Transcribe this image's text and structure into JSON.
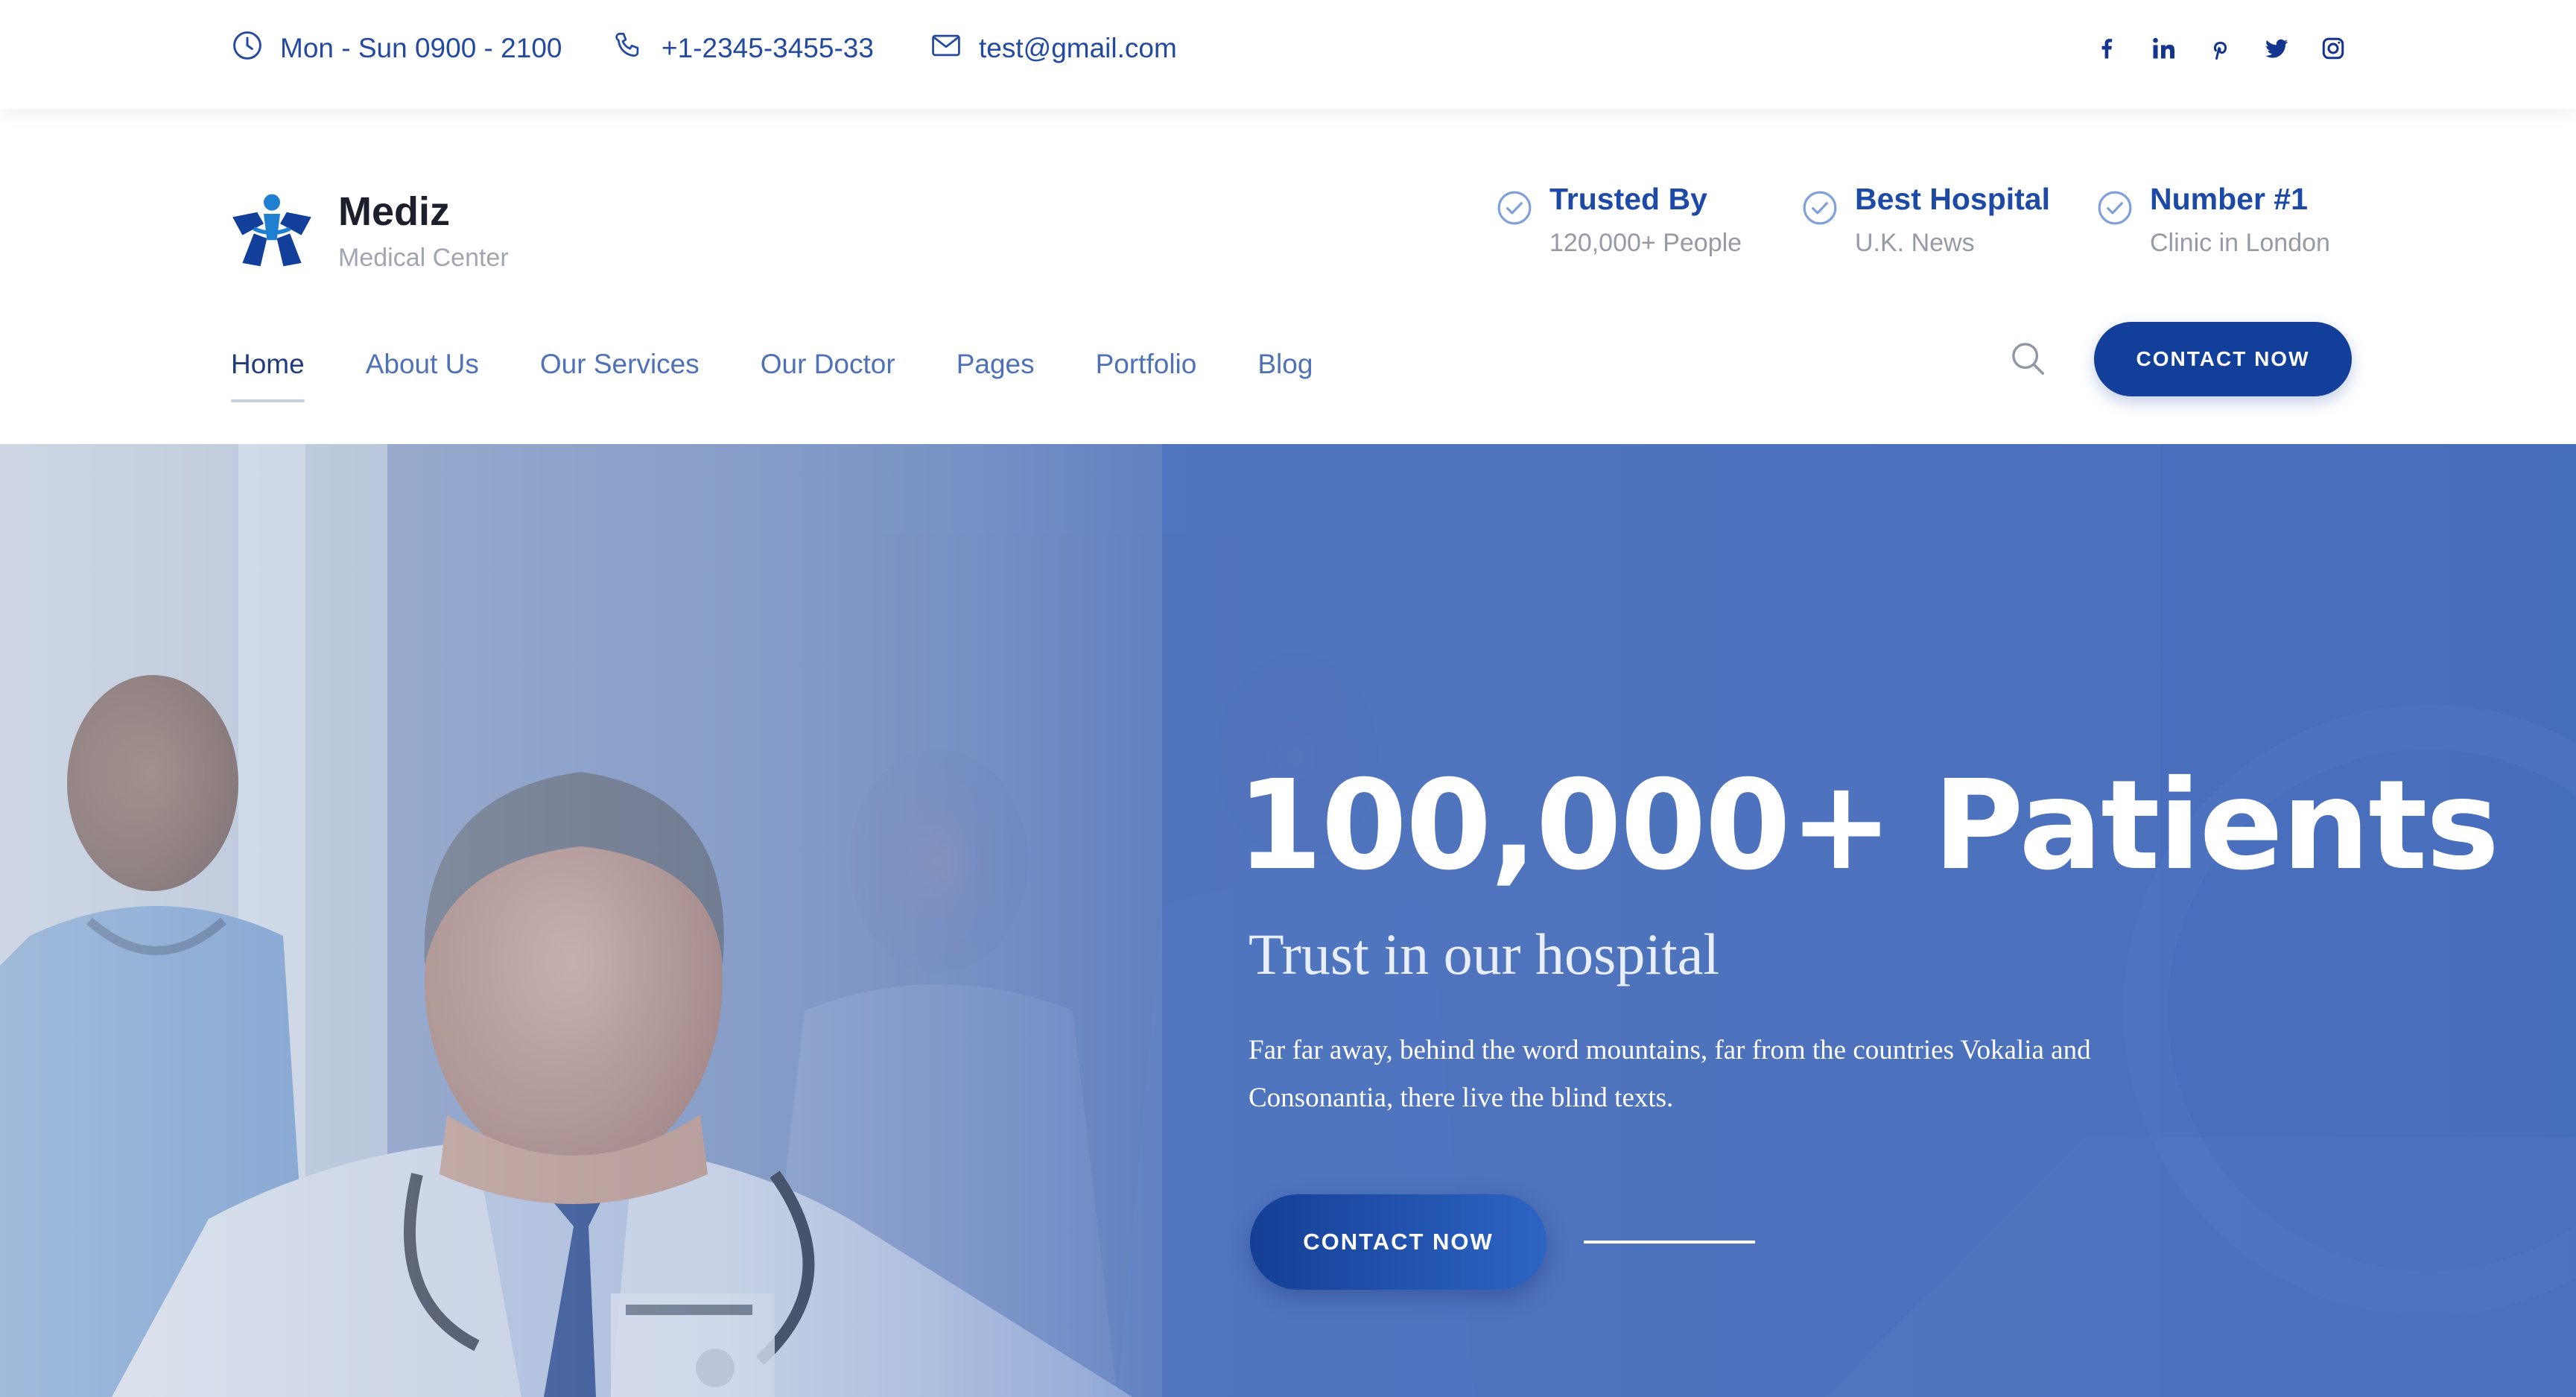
{
  "topbar": {
    "hours": "Mon - Sun 0900 - 2100",
    "phone": "+1-2345-3455-33",
    "email": "test@gmail.com",
    "social_icons": [
      "facebook-icon",
      "linkedin-icon",
      "pinterest-icon",
      "twitter-icon",
      "instagram-icon"
    ]
  },
  "brand": {
    "name": "Mediz",
    "tagline": "Medical Center"
  },
  "trust_badges": [
    {
      "title": "Trusted By",
      "subtitle": "120,000+ People"
    },
    {
      "title": "Best Hospital",
      "subtitle": "U.K. News"
    },
    {
      "title": "Number #1",
      "subtitle": "Clinic in London"
    }
  ],
  "nav": {
    "items": [
      "Home",
      "About Us",
      "Our Services",
      "Our Doctor",
      "Pages",
      "Portfolio",
      "Blog"
    ],
    "active": "Home"
  },
  "header": {
    "cta_label": "CONTACT NOW"
  },
  "hero": {
    "title": "100,000+ Patients",
    "subtitle": "Trust in our hospital",
    "description": "Far far away, behind the word mountains, far from the countries Vokalia and Consonantia, there live the blind texts.",
    "cta_label": "CONTACT NOW"
  },
  "colors": {
    "primary": "#123f9a",
    "accent": "#1c4aa6",
    "nav_text": "#4f72b6",
    "hero_overlay": "#3a64b8"
  }
}
